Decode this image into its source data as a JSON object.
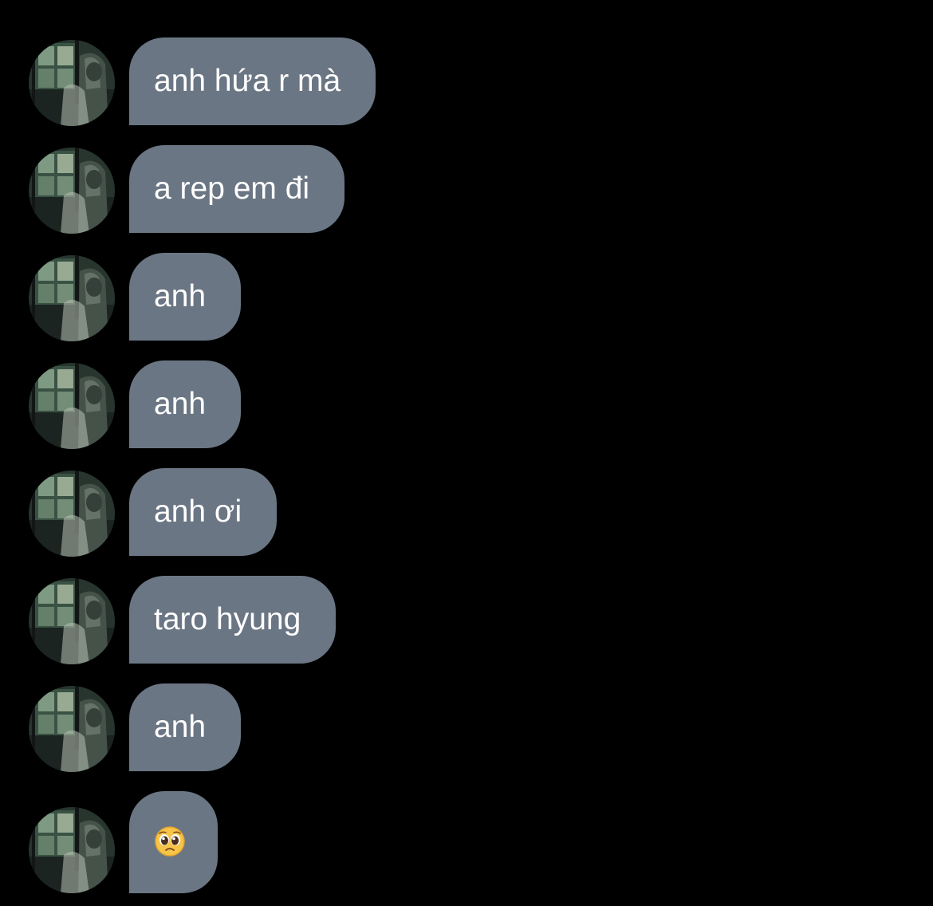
{
  "messages": [
    {
      "text": "anh hứa r mà"
    },
    {
      "text": "a rep em đi"
    },
    {
      "text": "anh"
    },
    {
      "text": "anh"
    },
    {
      "text": "anh ơi"
    },
    {
      "text": "taro hyung"
    },
    {
      "text": "anh"
    },
    {
      "emoji": "pleading-face-emoji"
    }
  ],
  "colors": {
    "background": "#000000",
    "bubble": "#6b7684",
    "bubble_text": "#ffffff"
  }
}
